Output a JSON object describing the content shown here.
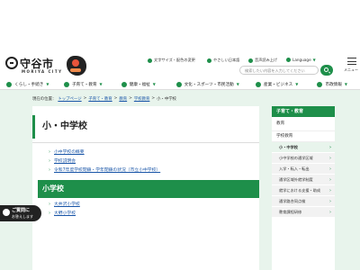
{
  "site": {
    "name": "守谷市",
    "sub": "MORIYA CITY"
  },
  "utility": {
    "text_size": "文字サイズ・配色の変更",
    "easy_japanese": "やさしい日本語",
    "voice": "音声読み上げ",
    "language": "Language"
  },
  "search": {
    "placeholder": "検索したい内容を入力してください"
  },
  "menu": {
    "label": "メニュー"
  },
  "catnav": [
    "くらし・手続き",
    "子育て・教育",
    "健康・福祉",
    "文化・スポーツ・市民活動",
    "産業・ビジネス",
    "市政情報"
  ],
  "breadcrumb": {
    "prefix": "現在の位置：",
    "items": [
      "トップページ",
      "子育て・教育",
      "教育",
      "学校教育"
    ],
    "current": "小・中学校"
  },
  "page": {
    "title": "小・中学校",
    "links": [
      "小中学校の概要",
      "学校説明会",
      "令和7年度学校閉鎖・学年閉鎖の状況（市立小中学校）"
    ],
    "section_title": "小学校",
    "section_links": [
      "大井沢小学校",
      "大野小学校"
    ]
  },
  "help": {
    "line1": "ご質問に",
    "line2": "お答えします"
  },
  "sidebar": {
    "head": "子育て・教育",
    "level1": "教育",
    "level2": "学校教育",
    "items": [
      "小・中学校",
      "小中学校の通学区域",
      "入学・転入・転出",
      "通学区域外就学制度",
      "就学における支援・助成",
      "通学路合同点検",
      "教育課程研修"
    ],
    "active_index": 0
  },
  "colors": {
    "accent": "#1e8f4a",
    "bg_band": "#e8f4ec",
    "link": "#1a56a8"
  }
}
